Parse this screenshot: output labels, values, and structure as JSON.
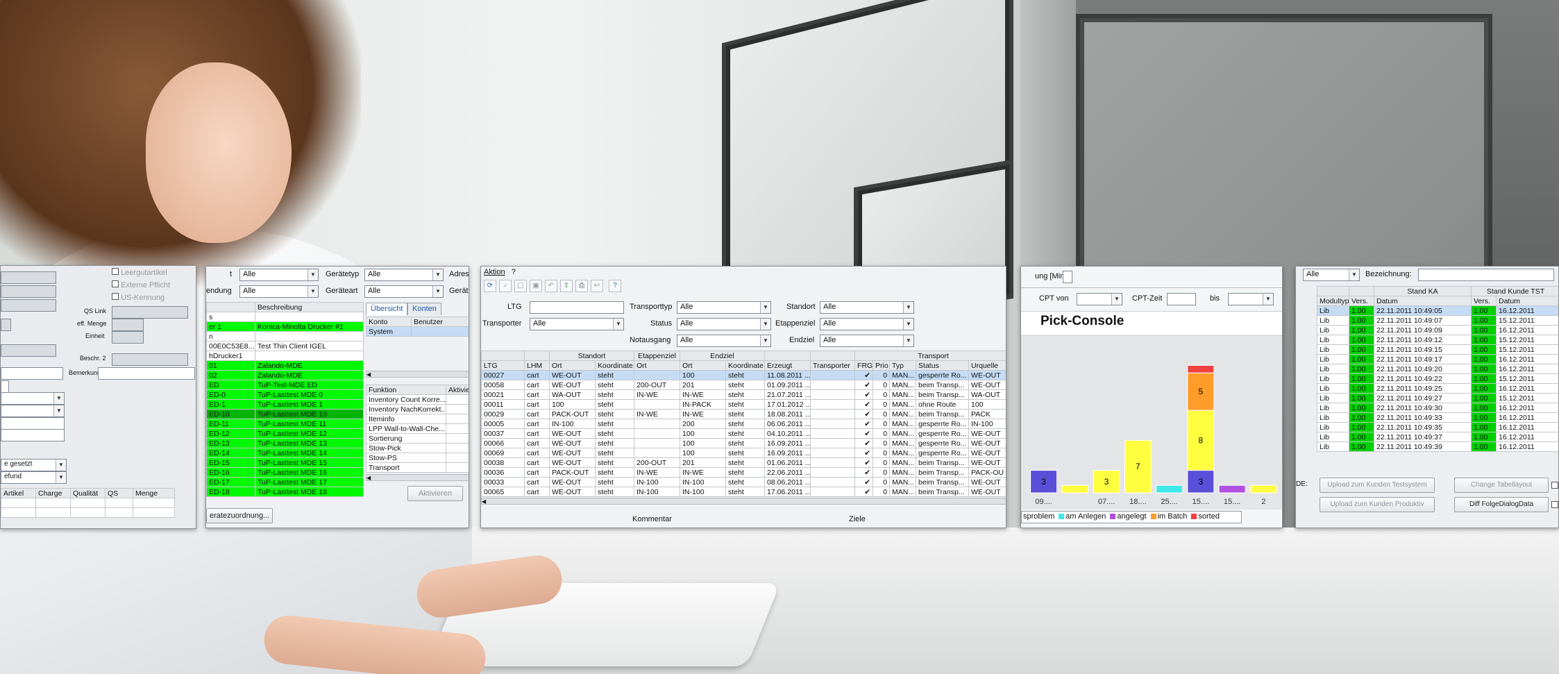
{
  "win1": {
    "labels": {
      "leerarbeit": "Leergutartikel",
      "externe": "Externe Pflicht",
      "us_kennung": "US-Kennung",
      "qs_link": "QS Link",
      "eff_menge": "eff. Menge",
      "einheit": "Einheit",
      "beschr2": "Beschr. 2",
      "bemerkung": "Bemerkung",
      "gesetzt": "e gesetzt",
      "befund": "efund"
    },
    "table": {
      "headers": [
        "Artikel",
        "Charge",
        "Qualität",
        "QS",
        "Menge"
      ]
    }
  },
  "win2": {
    "labels": {
      "t": "t",
      "endung": "endung",
      "geraetetyp": "Gerätetyp",
      "geraeteart": "Geräteart",
      "adres": "Adres",
      "geraet": "Gerät"
    },
    "combos": {
      "a": "Alle",
      "b": "Alle",
      "c": "Alle",
      "d": "Alle"
    },
    "table": {
      "headers": [
        "",
        "Beschreibung"
      ],
      "rows": [
        {
          "id": "s",
          "desc": "",
          "hl": ""
        },
        {
          "id": "er 1",
          "desc": "Konica-Minolta Drucker #1",
          "hl": "green"
        },
        {
          "id": "n",
          "desc": "",
          "hl": ""
        },
        {
          "id": "00E0C53E8...",
          "desc": "Test Thin Client IGEL",
          "hl": ""
        },
        {
          "id": "hDrucker1",
          "desc": "",
          "hl": ""
        },
        {
          "id": "01",
          "desc": "Zalando-MDE",
          "hl": "green"
        },
        {
          "id": "02",
          "desc": "Zalando-MDE",
          "hl": "green"
        },
        {
          "id": "ED",
          "desc": "TuP-Test-MDE ED",
          "hl": "green"
        },
        {
          "id": "ED-0",
          "desc": "TuP-Lasttest MDE 0",
          "hl": "green"
        },
        {
          "id": "ED-1",
          "desc": "TuP-Lasttest MDE 1",
          "hl": "green"
        },
        {
          "id": "ED-10",
          "desc": "TuP-Lasttest MDE 10",
          "hl": "darkg"
        },
        {
          "id": "ED-11",
          "desc": "TuP-Lasttest MDE 11",
          "hl": "green"
        },
        {
          "id": "ED-12",
          "desc": "TuP-Lasttest MDE 12",
          "hl": "green"
        },
        {
          "id": "ED-13",
          "desc": "TuP-Lasttest MDE 13",
          "hl": "green"
        },
        {
          "id": "ED-14",
          "desc": "TuP-Lasttest MDE 14",
          "hl": "green"
        },
        {
          "id": "ED-15",
          "desc": "TuP-Lasttest MDE 15",
          "hl": "green"
        },
        {
          "id": "ED-16",
          "desc": "TuP-Lasttest MDE 16",
          "hl": "green"
        },
        {
          "id": "ED-17",
          "desc": "TuP-Lasttest MDE 17",
          "hl": "green"
        },
        {
          "id": "ED-18",
          "desc": "TuP-Lasttest MDE 18",
          "hl": "green"
        }
      ]
    },
    "tabs": [
      "Übersicht",
      "Konten"
    ],
    "konto_headers": [
      "Konto",
      "Benutzer"
    ],
    "konto_row": "System",
    "funk_headers": [
      "Funktion",
      "Aktivie"
    ],
    "funktionen": [
      "Inventory Count Korre...",
      "Inventory NachKorrekt...",
      "Iteminfo",
      "LPP Wall-to-Wall-Che...",
      "Sortierung",
      "Stow-Pick",
      "Stow-PS",
      "Transport"
    ],
    "aktivieren": "Aktivieren",
    "zuordnung": "eratezuordnung..."
  },
  "win3": {
    "menu": [
      "Aktion",
      "?"
    ],
    "form": {
      "ltg": "LTG",
      "transporter": "Transporter",
      "transporttyp": "Transporttyp",
      "status": "Status",
      "notausgang": "Notausgang",
      "standort": "Standort",
      "etappenziel": "Etappenziel",
      "endziel": "Endziel",
      "v_transporter": "Alle",
      "v_transporttyp": "Alle",
      "v_status": "Alle",
      "v_notausgang": "Alle",
      "v_standort": "Alle",
      "v_etappenziel": "Alle",
      "v_endziel": "Alle"
    },
    "groups": [
      "Standort",
      "Etappenziel",
      "Endziel",
      "Transport"
    ],
    "headers": [
      "LTG",
      "LHM",
      "Ort",
      "Koordinate",
      "Ort",
      "Ort",
      "Koordinate",
      "Erzeugt",
      "Transporter",
      "FRG",
      "Prio",
      "Typ",
      "Status",
      "Urquelle"
    ],
    "rows": [
      [
        "00027",
        "cart",
        "WE-OUT",
        "steht",
        "",
        "100",
        "steht",
        "11.08.2011 ...",
        "",
        "✔",
        "0",
        "MAN...",
        "gesperrte Ro...",
        "WE-OUT"
      ],
      [
        "00058",
        "cart",
        "WE-OUT",
        "steht",
        "200-OUT",
        "201",
        "steht",
        "01.09.2011 ...",
        "",
        "✔",
        "0",
        "MAN...",
        "beim Transp...",
        "WE-OUT"
      ],
      [
        "00021",
        "cart",
        "WA-OUT",
        "steht",
        "IN-WE",
        "IN-WE",
        "steht",
        "21.07.2011 ...",
        "",
        "✔",
        "0",
        "MAN...",
        "beim Transp...",
        "WA-OUT"
      ],
      [
        "00011",
        "cart",
        "100",
        "steht",
        "",
        "IN-PACK",
        "steht",
        "17.01.2012 ...",
        "",
        "✔",
        "0",
        "MAN...",
        "ohne Route",
        "100"
      ],
      [
        "00029",
        "cart",
        "PACK-OUT",
        "steht",
        "IN-WE",
        "IN-WE",
        "steht",
        "18.08.2011 ...",
        "",
        "✔",
        "0",
        "MAN...",
        "beim Transp...",
        "PACK"
      ],
      [
        "00005",
        "cart",
        "IN-100",
        "steht",
        "",
        "200",
        "steht",
        "06.06.2011 ...",
        "",
        "✔",
        "0",
        "MAN...",
        "gesperrte Ro...",
        "IN-100"
      ],
      [
        "00037",
        "cart",
        "WE-OUT",
        "steht",
        "",
        "100",
        "steht",
        "04.10.2011 ...",
        "",
        "✔",
        "0",
        "MAN...",
        "gesperrte Ro...",
        "WE-OUT"
      ],
      [
        "00066",
        "cart",
        "WE-OUT",
        "steht",
        "",
        "100",
        "steht",
        "16.09.2011 ...",
        "",
        "✔",
        "0",
        "MAN...",
        "gesperrte Ro...",
        "WE-OUT"
      ],
      [
        "00069",
        "cart",
        "WE-OUT",
        "steht",
        "",
        "100",
        "steht",
        "16.09.2011 ...",
        "",
        "✔",
        "0",
        "MAN...",
        "gesperrte Ro...",
        "WE-OUT"
      ],
      [
        "00038",
        "cart",
        "WE-OUT",
        "steht",
        "200-OUT",
        "201",
        "steht",
        "01.06.2011 ...",
        "",
        "✔",
        "0",
        "MAN...",
        "beim Transp...",
        "WE-OUT"
      ],
      [
        "00036",
        "cart",
        "PACK-OUT",
        "steht",
        "IN-WE",
        "IN-WE",
        "steht",
        "22.06.2011 ...",
        "",
        "✔",
        "0",
        "MAN...",
        "beim Transp...",
        "PACK-OU"
      ],
      [
        "00033",
        "cart",
        "WE-OUT",
        "steht",
        "IN-100",
        "IN-100",
        "steht",
        "08.06.2011 ...",
        "",
        "✔",
        "0",
        "MAN...",
        "beim Transp...",
        "WE-OUT"
      ],
      [
        "00065",
        "cart",
        "WE-OUT",
        "steht",
        "IN-100",
        "IN-100",
        "steht",
        "17.06.2011 ...",
        "",
        "✔",
        "0",
        "MAN...",
        "beim Transp...",
        "WE-OUT"
      ]
    ],
    "kommentar": "Kommentar",
    "ziele": "Ziele"
  },
  "win4": {
    "top": "ung [Min]",
    "cpt_von": "CPT von",
    "cpt_zeit": "CPT-Zeit",
    "bis": "bis",
    "title": "Pick-Console",
    "legend": [
      {
        "label": "sproblem",
        "color": "#5a4fd8"
      },
      {
        "label": "am Anlegen",
        "color": "#40e8e8"
      },
      {
        "label": "angelegt",
        "color": "#b050e0"
      },
      {
        "label": "im Batch",
        "color": "#ff9c2a"
      },
      {
        "label": "sorted",
        "color": "#f04040"
      }
    ]
  },
  "chart_data": {
    "type": "bar",
    "title": "Pick-Console",
    "categories": [
      "09....",
      "",
      "07....",
      "18....",
      "25....",
      "15....",
      "15....",
      "2"
    ],
    "series": [
      {
        "name": "sproblem",
        "color": "#5a4fd8",
        "values": [
          3,
          0,
          0,
          0,
          0,
          3,
          0,
          0
        ]
      },
      {
        "name": "am Anlegen",
        "color": "#40e8e8",
        "values": [
          0,
          0,
          0,
          0,
          1,
          0,
          0,
          0
        ]
      },
      {
        "name": "angelegt",
        "color": "#b050e0",
        "values": [
          0,
          0,
          0,
          0,
          0,
          0,
          1,
          0
        ]
      },
      {
        "name": "im Batch",
        "color": "#ff9c2a",
        "values": [
          0,
          0,
          0,
          0,
          0,
          5,
          0,
          0
        ]
      },
      {
        "name": "yellow",
        "color": "#ffff40",
        "values": [
          0,
          1,
          3,
          7,
          0,
          8,
          0,
          1
        ]
      },
      {
        "name": "sorted",
        "color": "#f04040",
        "values": [
          0,
          0,
          0,
          0,
          0,
          1,
          0,
          0
        ]
      }
    ],
    "bar_labels": [
      [
        "3"
      ],
      [],
      [
        "3"
      ],
      [
        "7"
      ],
      [],
      [
        "3",
        "8",
        "5"
      ],
      [],
      []
    ],
    "ylim": [
      0,
      20
    ]
  },
  "win5": {
    "combo": "Alle",
    "bezeichnung": "Bezeichnung:",
    "groups": [
      "Stand KA",
      "Stand Kunde TST"
    ],
    "headers": [
      "Modultyp",
      "Vers.",
      "Datum",
      "Vers.",
      "Datum"
    ],
    "rows": [
      [
        "Lib",
        "1.00",
        "22.11.2011 10:49:05",
        "1.00",
        "16.12.2011"
      ],
      [
        "Lib",
        "1.00",
        "22.11.2011 10:49:07",
        "1.00",
        "15.12.2011"
      ],
      [
        "Lib",
        "1.00",
        "22.11.2011 10:49:09",
        "1.00",
        "16.12.2011"
      ],
      [
        "Lib",
        "1.00",
        "22.11.2011 10:49:12",
        "1.00",
        "15.12.2011"
      ],
      [
        "Lib",
        "1.00",
        "22.11.2011 10:49:15",
        "1.00",
        "15.12.2011"
      ],
      [
        "Lib",
        "1.00",
        "22.11.2011 10:49:17",
        "1.00",
        "16.12.2011"
      ],
      [
        "Lib",
        "1.00",
        "22.11.2011 10:49:20",
        "1.00",
        "16.12.2011"
      ],
      [
        "Lib",
        "1.00",
        "22.11.2011 10:49:22",
        "1.00",
        "15.12.2011"
      ],
      [
        "Lib",
        "1.00",
        "22.11.2011 10:49:25",
        "1.00",
        "16.12.2011"
      ],
      [
        "Lib",
        "1.00",
        "22.11.2011 10:49:27",
        "1.00",
        "15.12.2011"
      ],
      [
        "Lib",
        "1.00",
        "22.11.2011 10:49:30",
        "1.00",
        "16.12.2011"
      ],
      [
        "Lib",
        "1.00",
        "22.11.2011 10:49:33",
        "1.00",
        "16.12.2011"
      ],
      [
        "Lib",
        "1.00",
        "22.11.2011 10:49:35",
        "1.00",
        "16.12.2011"
      ],
      [
        "Lib",
        "1.00",
        "22.11.2011 10:49:37",
        "1.00",
        "16.12.2011"
      ],
      [
        "Lib",
        "1.00",
        "22.11.2011 10:49:39",
        "1.00",
        "16.12.2011"
      ]
    ],
    "de": "DE:",
    "btn_upload_fest": "Upload zum Kunden Testsystem",
    "btn_change": "Change Tabellayout",
    "btn_upload_prod": "Upload zum Kunden Produktiv",
    "btn_diff": "Diff FolgeDialogData"
  }
}
